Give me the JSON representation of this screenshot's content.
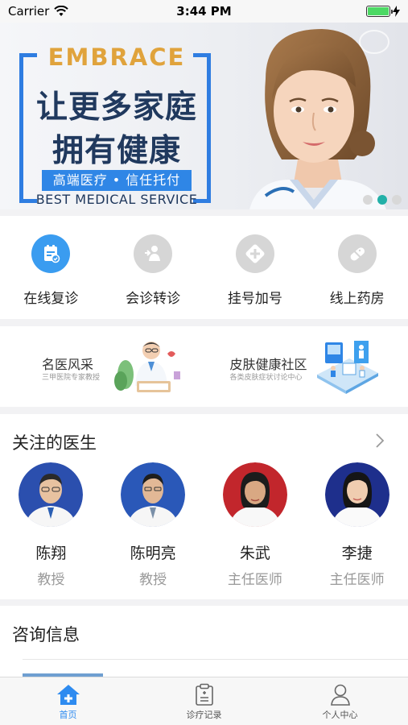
{
  "status_bar": {
    "carrier": "Carrier",
    "time": "3:44 PM",
    "battery_level": 1.0
  },
  "banner": {
    "kicker": "EMBRACE",
    "headline_line1": "让更多家庭",
    "headline_line2": "拥有健康",
    "pill": "高端医疗 • 信任托付",
    "english": "BEST MEDICAL SERVICE",
    "active_slide": 2,
    "slide_count": 3
  },
  "services": [
    {
      "label": "在线复诊",
      "icon": "online-revisit-icon"
    },
    {
      "label": "会诊转诊",
      "icon": "consult-referral-icon"
    },
    {
      "label": "挂号加号",
      "icon": "register-plus-icon"
    },
    {
      "label": "线上药房",
      "icon": "pill-icon"
    }
  ],
  "features": [
    {
      "title": "名医风采",
      "subtitle": "三甲医院专家教授"
    },
    {
      "title": "皮肤健康社区",
      "subtitle": "各类皮肤症状讨论中心"
    }
  ],
  "doctors_section": {
    "title": "关注的医生",
    "doctors": [
      {
        "name": "陈翔",
        "title": "教授"
      },
      {
        "name": "陈明亮",
        "title": "教授"
      },
      {
        "name": "朱武",
        "title": "主任医师"
      },
      {
        "name": "李捷",
        "title": "主任医师"
      }
    ]
  },
  "consult_section": {
    "title": "咨询信息"
  },
  "tabbar": {
    "tabs": [
      {
        "label": "首页",
        "icon": "home-icon",
        "active": true
      },
      {
        "label": "诊疗记录",
        "icon": "clipboard-icon",
        "active": false
      },
      {
        "label": "个人中心",
        "icon": "person-icon",
        "active": false
      }
    ]
  },
  "colors": {
    "accent": "#2e8bf0",
    "banner_blue": "#2f7de1",
    "banner_gold": "#e0a33c",
    "carousel_active": "#22b0a8"
  }
}
